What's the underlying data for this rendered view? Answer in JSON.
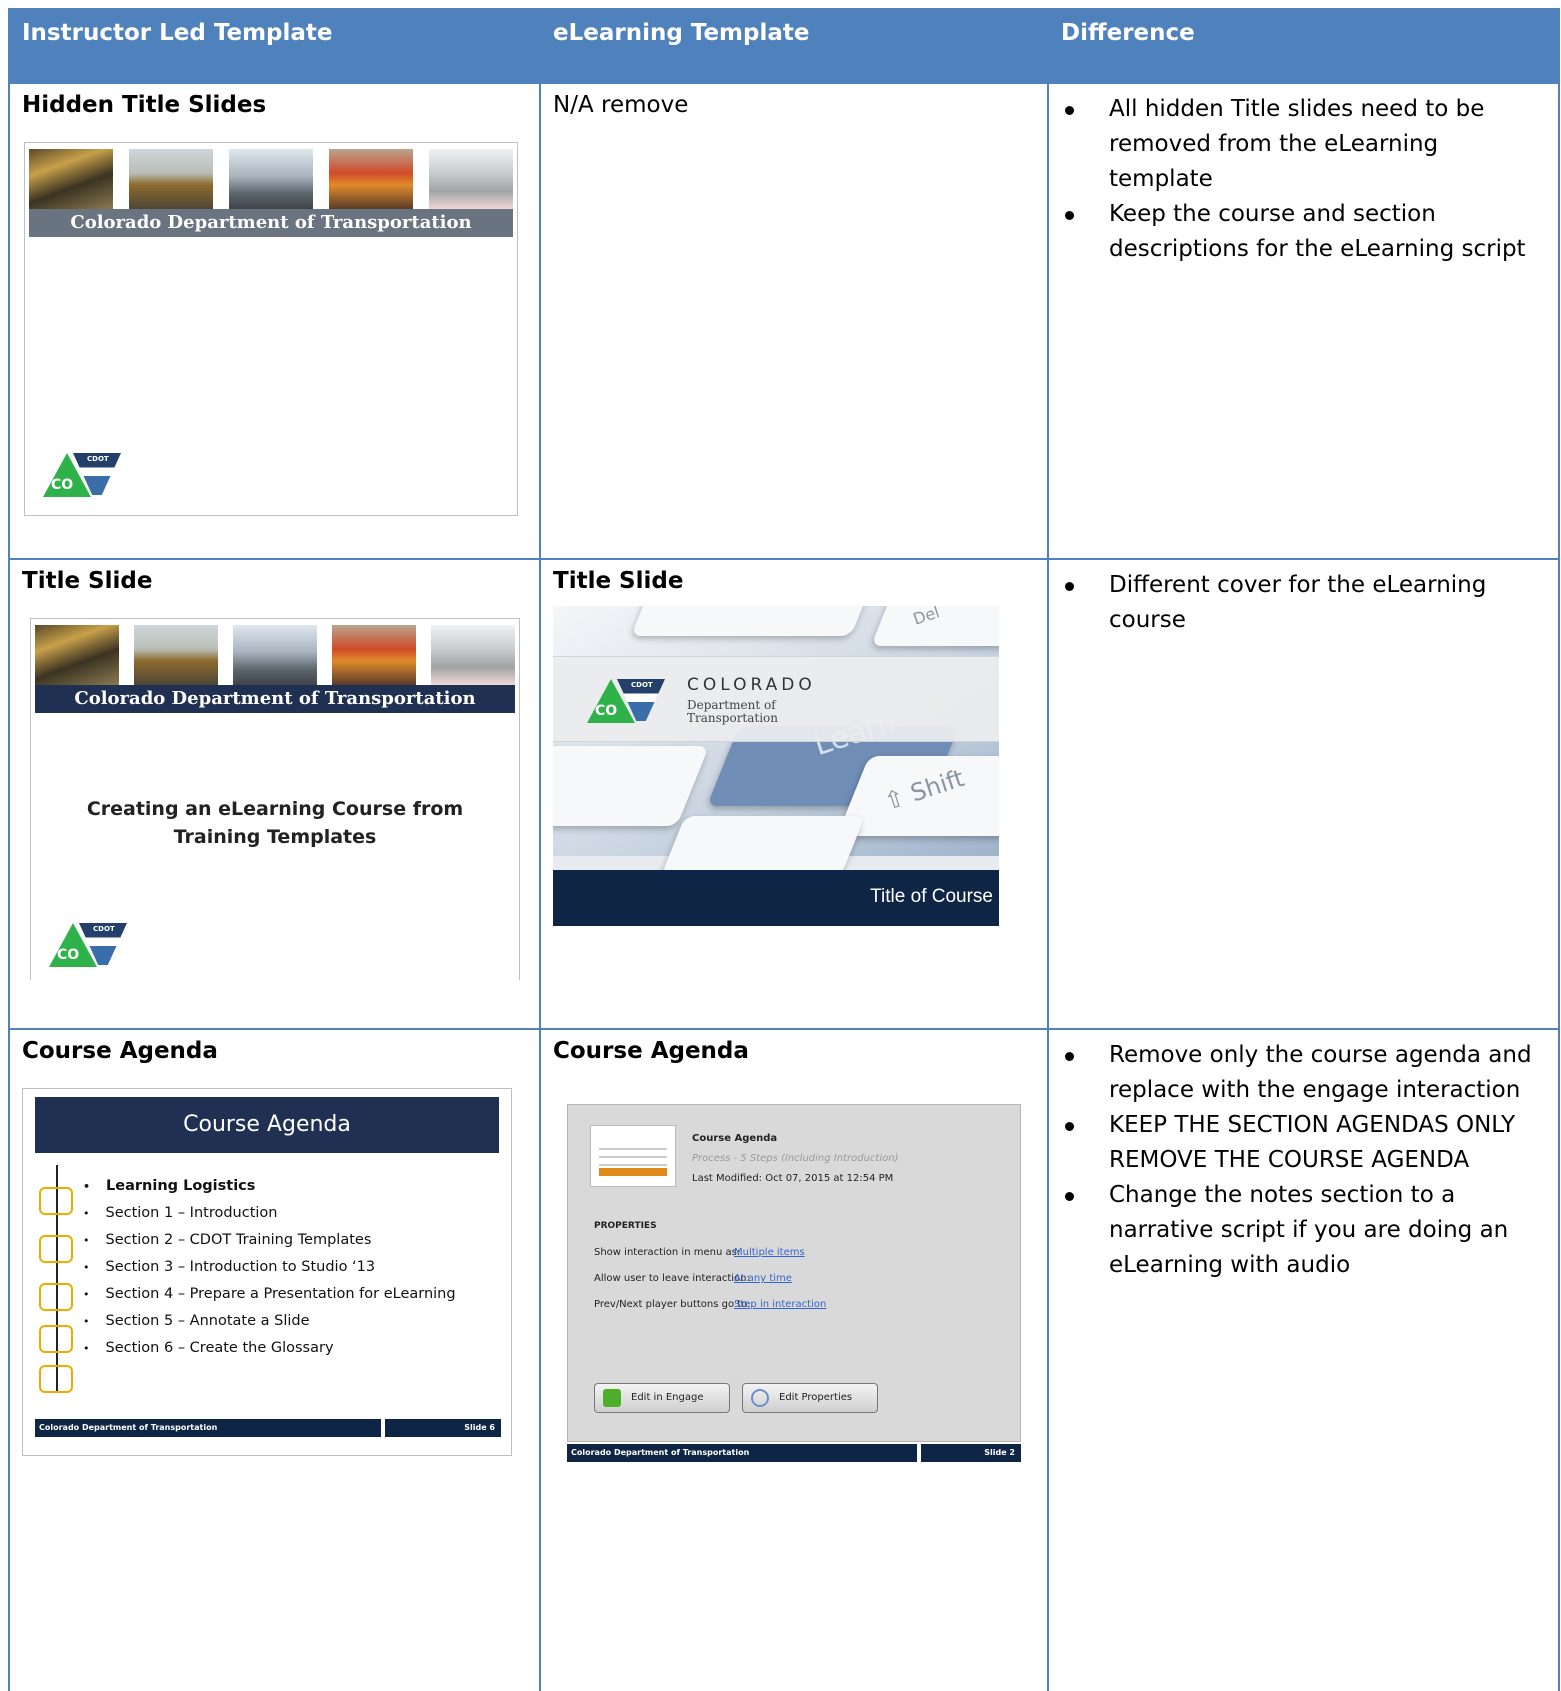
{
  "table": {
    "headers": [
      "Instructor Led Template",
      "eLearning Template",
      "Difference"
    ],
    "rows": [
      {
        "ilt_title": "Hidden Title Slides",
        "elearn_text": "N/A remove",
        "diff": [
          "All hidden Title slides need to be removed from the eLearning template",
          "Keep the course and section descriptions for the eLearning script"
        ]
      },
      {
        "ilt_title": "Title Slide",
        "elearn_title": "Title Slide",
        "diff": [
          "Different cover for the eLearning course"
        ]
      },
      {
        "ilt_title": "Course Agenda",
        "elearn_title": "Course Agenda",
        "diff": [
          "Remove only the course agenda and replace with the engage interaction",
          "KEEP THE SECTION AGENDAS ONLY REMOVE THE COURSE AGENDA",
          "Change the notes section to a narrative script if you are doing an eLearning with audio"
        ]
      }
    ]
  },
  "slides": {
    "banner_text": "Colorado Department of Transportation",
    "title_slide_text": "Creating an eLearning Course from Training Templates",
    "logo_co": "CO",
    "logo_cdot": "CDOT",
    "cover": {
      "brand": "COLORADO",
      "sub1": "Department of",
      "sub2": "Transportation",
      "footer_title": "Title of Course",
      "key_shift": "⇧ Shift",
      "key_learn": "Learn",
      "key_del": "Del"
    },
    "agenda": {
      "heading": "Course Agenda",
      "items": [
        "Learning Logistics",
        "Section 1 – Introduction",
        "Section 2 – CDOT Training Templates",
        "Section 3 – Introduction to Studio ‘13",
        "Section 4 – Prepare a Presentation for eLearning",
        "Section 5 – Annotate a Slide",
        "Section 6 – Create the Glossary"
      ],
      "footer_left": "Colorado Department of Transportation",
      "footer_right": "Slide 6"
    },
    "engage": {
      "title": "Course Agenda",
      "process": "Process - 5 Steps (Including Introduction)",
      "modified": "Last Modified: Oct 07, 2015 at 12:54 PM",
      "properties": "PROPERTIES",
      "prop1_label": "Show interaction in menu as:",
      "prop1_value": "Multiple items",
      "prop2_label": "Allow user to leave interaction:",
      "prop2_value": "At any time",
      "prop3_label": "Prev/Next player buttons go to:",
      "prop3_value": "Step in interaction",
      "btn_engage": "Edit in Engage",
      "btn_props": "Edit Properties",
      "footer_left": "Colorado Department of Transportation",
      "footer_right": "Slide 2"
    }
  },
  "colors": {
    "header_bg": "#4f81bd",
    "navy": "#1f3052",
    "green": "#2fb24a",
    "orange": "#f2a900"
  }
}
